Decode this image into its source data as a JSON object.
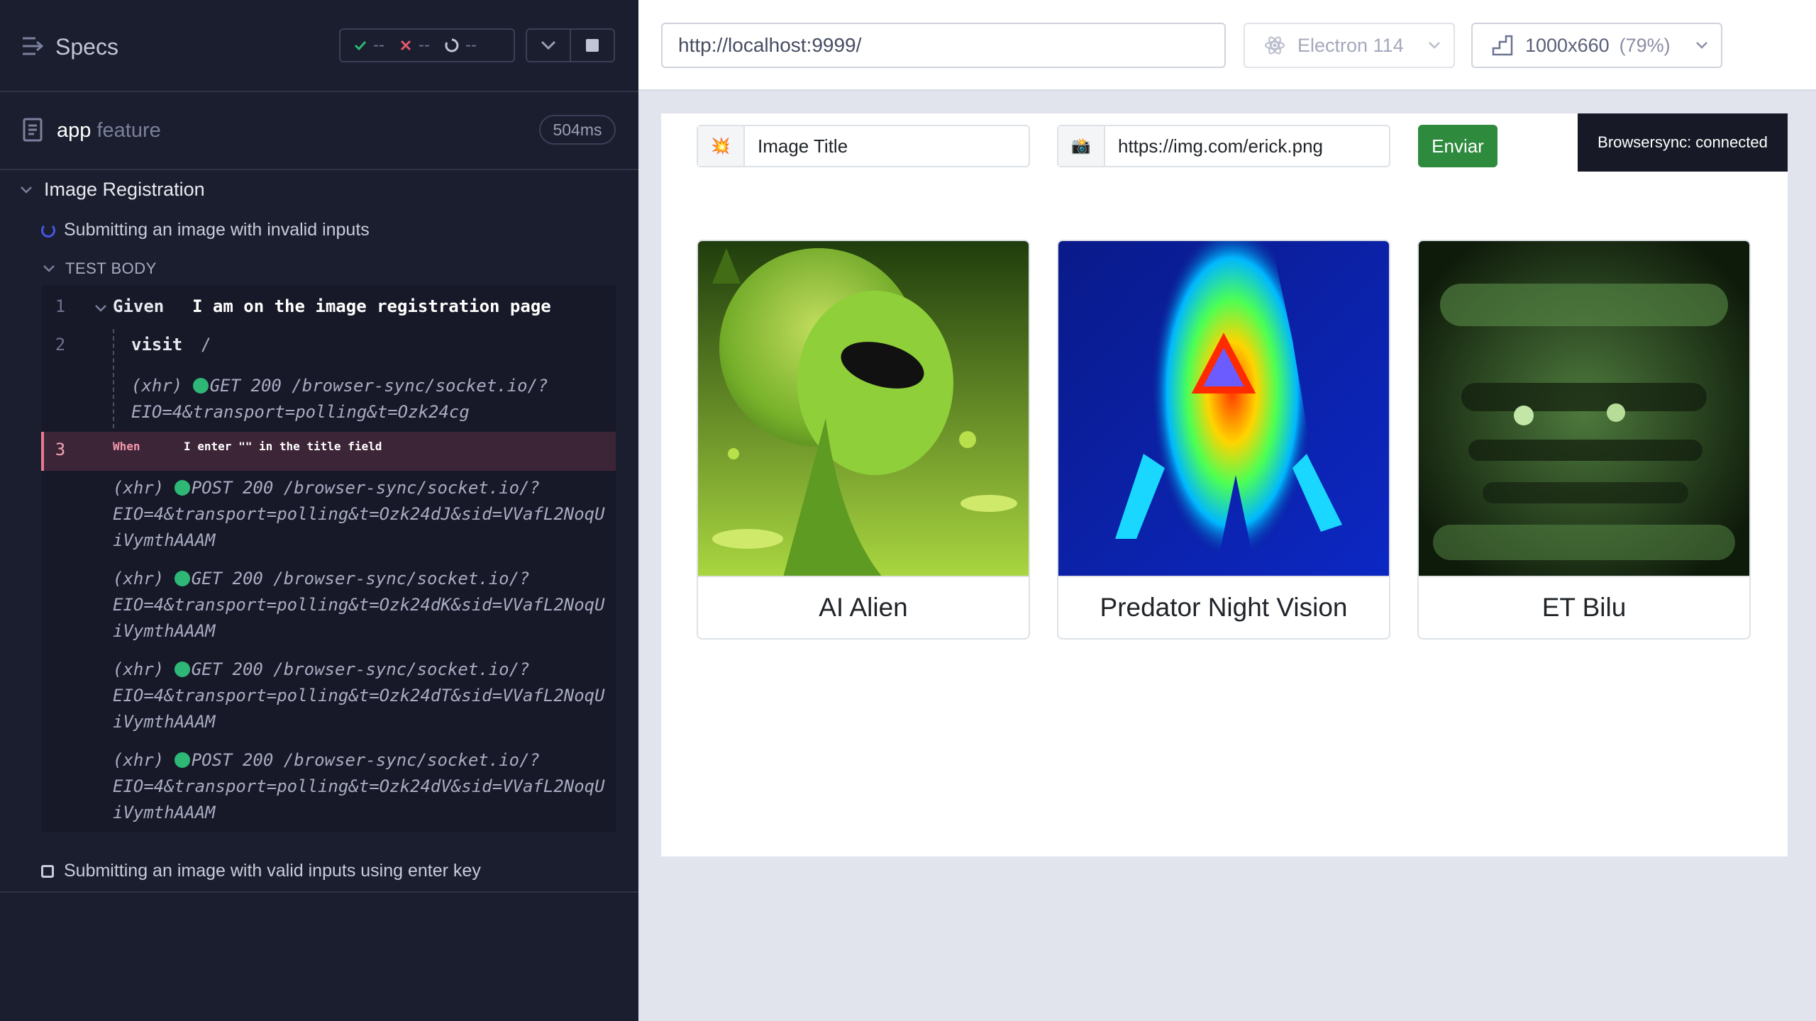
{
  "reporter": {
    "title": "Specs",
    "stats": {
      "passed": "--",
      "failed": "--",
      "pending": "--"
    },
    "spec": {
      "name": "app",
      "ext": "feature",
      "duration": "504ms"
    },
    "suite": "Image Registration",
    "test1": "Submitting an image with invalid inputs",
    "test_body_label": "TEST BODY",
    "commands": {
      "c1": {
        "num": "1",
        "keyword": "Given",
        "text": "I am on the image registration page"
      },
      "c2": {
        "num": "2",
        "keyword": "visit",
        "text": "/"
      },
      "c2_log_a": "(xhr) ",
      "c2_log_b": "GET 200 /browser-sync/socket.io/?",
      "c2_log_c": "EIO=4&transport=polling&t=Ozk24cg",
      "c3": {
        "num": "3",
        "keyword": "When",
        "text": "I enter \"\" in the title field"
      },
      "logs": [
        {
          "prefix": "(xhr) ",
          "line1": "POST 200 /browser-sync/socket.io/?",
          "line2": "EIO=4&transport=polling&t=Ozk24dJ&sid=VVafL2NoqU",
          "line3": "iVymthAAAM"
        },
        {
          "prefix": "(xhr) ",
          "line1": "GET 200 /browser-sync/socket.io/?",
          "line2": "EIO=4&transport=polling&t=Ozk24dK&sid=VVafL2NoqU",
          "line3": "iVymthAAAM"
        },
        {
          "prefix": "(xhr) ",
          "line1": "GET 200 /browser-sync/socket.io/?",
          "line2": "EIO=4&transport=polling&t=Ozk24dT&sid=VVafL2NoqU",
          "line3": "iVymthAAAM"
        },
        {
          "prefix": "(xhr) ",
          "line1": "POST 200 /browser-sync/socket.io/?",
          "line2": "EIO=4&transport=polling&t=Ozk24dV&sid=VVafL2NoqU",
          "line3": "iVymthAAAM"
        }
      ]
    },
    "test2": "Submitting an image with valid inputs using enter key"
  },
  "topbar": {
    "url": "http://localhost:9999/",
    "browser": "Electron 114",
    "viewport": "1000x660",
    "zoom": "(79%)"
  },
  "app": {
    "title_addon": "💥",
    "title_value": "Image Title",
    "url_addon": "📸",
    "url_value": "https://img.com/erick.png",
    "submit_label": "Enviar",
    "toast": "Browsersync: connected",
    "cards": [
      {
        "caption": "AI Alien"
      },
      {
        "caption": "Predator Night Vision"
      },
      {
        "caption": "ET Bilu"
      }
    ]
  },
  "colors": {
    "reporter_bg": "#1b1e2e",
    "active_row": "#3d2538",
    "submit": "#2e8b3e",
    "pass": "#2fb776",
    "fail": "#e05a6e"
  }
}
